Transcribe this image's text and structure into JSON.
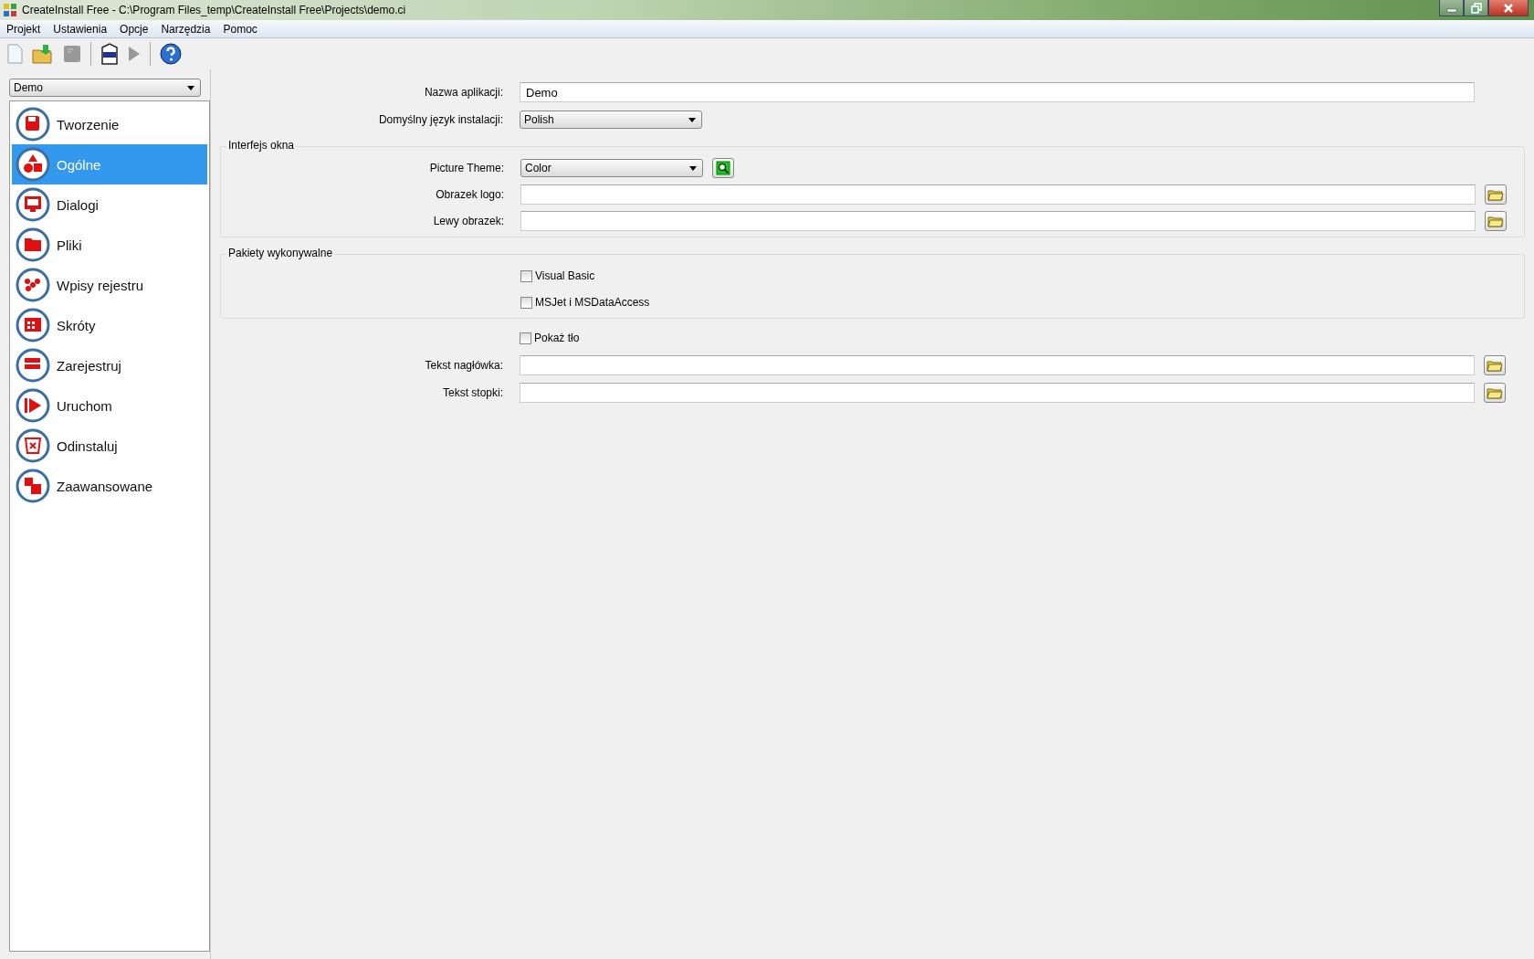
{
  "window": {
    "title": "CreateInstall Free - C:\\Program Files_temp\\CreateInstall Free\\Projects\\demo.ci"
  },
  "menu": [
    "Projekt",
    "Ustawienia",
    "Opcje",
    "Narzędzia",
    "Pomoc"
  ],
  "sidebar": {
    "project": "Demo",
    "items": [
      {
        "label": "Tworzenie",
        "selected": false
      },
      {
        "label": "Ogólne",
        "selected": true
      },
      {
        "label": "Dialogi",
        "selected": false
      },
      {
        "label": "Pliki",
        "selected": false
      },
      {
        "label": "Wpisy rejestru",
        "selected": false
      },
      {
        "label": "Skróty",
        "selected": false
      },
      {
        "label": "Zarejestruj",
        "selected": false
      },
      {
        "label": "Uruchom",
        "selected": false
      },
      {
        "label": "Odinstaluj",
        "selected": false
      },
      {
        "label": "Zaawansowane",
        "selected": false
      }
    ]
  },
  "sections": [
    {
      "kind": "plain",
      "rows": [
        {
          "kind": "text",
          "label": "Nazwa aplikacji:",
          "value": "Demo"
        },
        {
          "kind": "select",
          "label": "Domyślny język instalacji:",
          "value": "Polish"
        }
      ]
    },
    {
      "kind": "group",
      "title": "Interfejs okna",
      "rows": [
        {
          "kind": "select-preview",
          "label": "Picture Theme:",
          "value": "Color"
        },
        {
          "kind": "file",
          "label": "Obrazek logo:"
        },
        {
          "kind": "file",
          "label": "Lewy obrazek:"
        }
      ]
    },
    {
      "kind": "group",
      "title": "Pakiety wykonywalne",
      "rows": [
        {
          "kind": "checkbox",
          "label": "Visual Basic",
          "checked": false
        },
        {
          "kind": "checkbox",
          "label": "MSJet i MSDataAccess",
          "checked": false
        }
      ]
    },
    {
      "kind": "plain",
      "rows": [
        {
          "kind": "checkbox",
          "label": "Pokaż tło",
          "checked": false
        },
        {
          "kind": "file",
          "label": "Tekst nagłówka:"
        },
        {
          "kind": "file",
          "label": "Tekst stopki:"
        }
      ]
    }
  ]
}
